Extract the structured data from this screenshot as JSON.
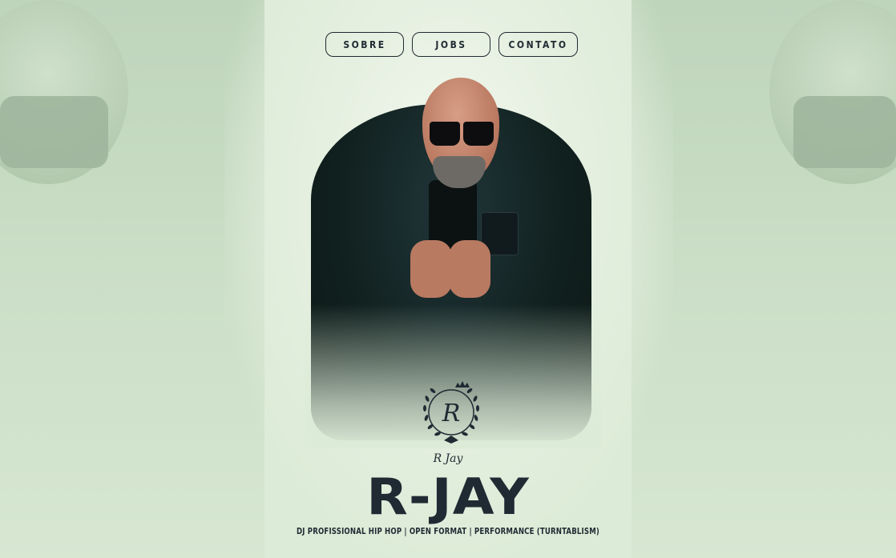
{
  "nav": {
    "sobre": "SOBRE",
    "jobs": "JOBS",
    "contato": "CONTATO"
  },
  "logo": {
    "monogram": "R",
    "signature": "R Jay"
  },
  "hero": {
    "title": "R-JAY",
    "subtitle": "DJ PROFISSIONAL HIP HOP | OPEN FORMAT | PERFORMANCE (TURNTABLISM)"
  },
  "colors": {
    "background": "#dcebd7",
    "text": "#1f2a33",
    "coat": "#11211f"
  }
}
